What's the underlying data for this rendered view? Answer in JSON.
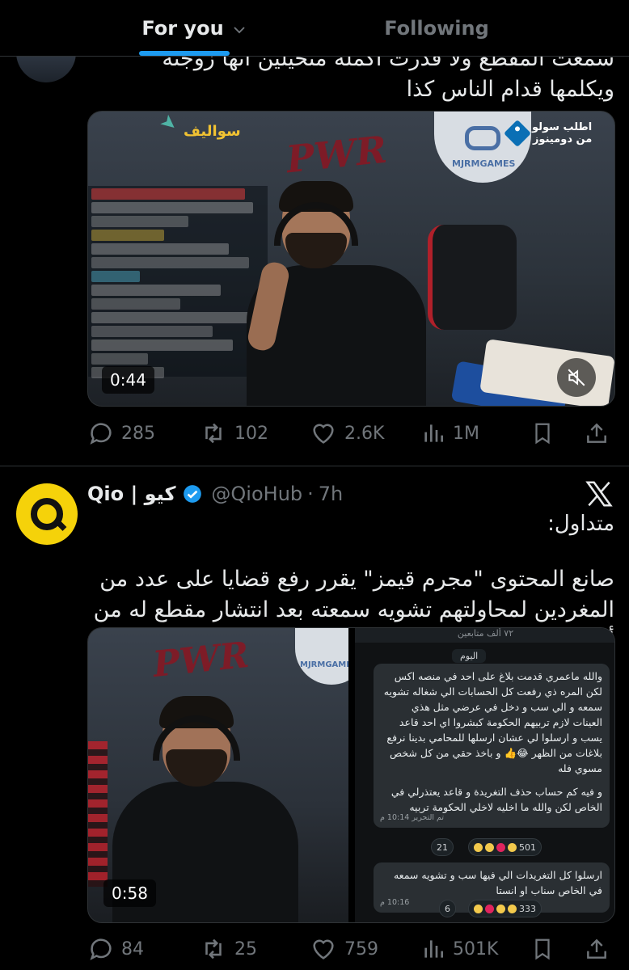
{
  "tabs": {
    "for_you": "For you",
    "following": "Following"
  },
  "tweet1": {
    "text": "سمعت المقطع ولا قدرت اكمله متخيلين انها زوجته ويكلمها قدام الناس كذا",
    "media": {
      "duration": "0:44",
      "overlay_brand": "سواليف",
      "sponsor_line1": "اطلب سولو",
      "sponsor_line2": "من دومينوز",
      "logo_text": "MJRMGAMES",
      "neon_sign": "PWR"
    },
    "stats": {
      "replies": "285",
      "retweets": "102",
      "likes": "2.6K",
      "views": "1M"
    }
  },
  "tweet2": {
    "author_name": "Qio | كيو",
    "handle": "@QioHub",
    "separator": "·",
    "time": "7h",
    "label": "متداول:",
    "text": "صانع المحتوى \"مجرم قيمز\" يقرر رفع قضايا على عدد من المغردين لمحاولتهم تشويه سمعته بعد انتشار مقطع له من أحد بثوثه 👀!",
    "media": {
      "duration": "0:58",
      "neon_sign": "PWR",
      "logo_text": "MJRMGAMES",
      "chat_header": "٧٢ ألف متابعين",
      "chat_day": "اليوم",
      "message1": "والله ماعمري قدمت بلاغ على احد في منصه اكس لكن المره ذي رفعت كل الحسابات الي شغاله تشويه سمعه و الي سب و دخل في عرضي مثل هذي العينات لازم تربيهم الحكومة كبشروا اي احد قاعد يسب و ارسلوا لي عشان ارسلها للمحامي بدينا نرفع بلاغات من الظهر 😂👍 و باخذ حقي من كل شخص مسوي فله",
      "message1_extra": "و فيه كم حساب حذف التغريدة و قاعد يعتذرلي في الخاص لكن والله ما اخليه لاخلي الحكومة تربيه",
      "message1_time": "تم التحرير 10:14 م",
      "message1_reacts": "501",
      "message1_reacts_extra": "21",
      "message2": "ارسلوا كل التغريدات الي فيها سب و تشويه سمعه في الخاص سناب او انستا",
      "message2_time": "10:16 م",
      "message2_reacts": "333",
      "message2_reacts_extra": "6"
    },
    "stats": {
      "replies": "84",
      "retweets": "25",
      "likes": "759",
      "views": "501K"
    }
  },
  "colors": {
    "accent": "#1d9bf0",
    "muted": "#71767b",
    "qio_yellow": "#f5d20a"
  }
}
